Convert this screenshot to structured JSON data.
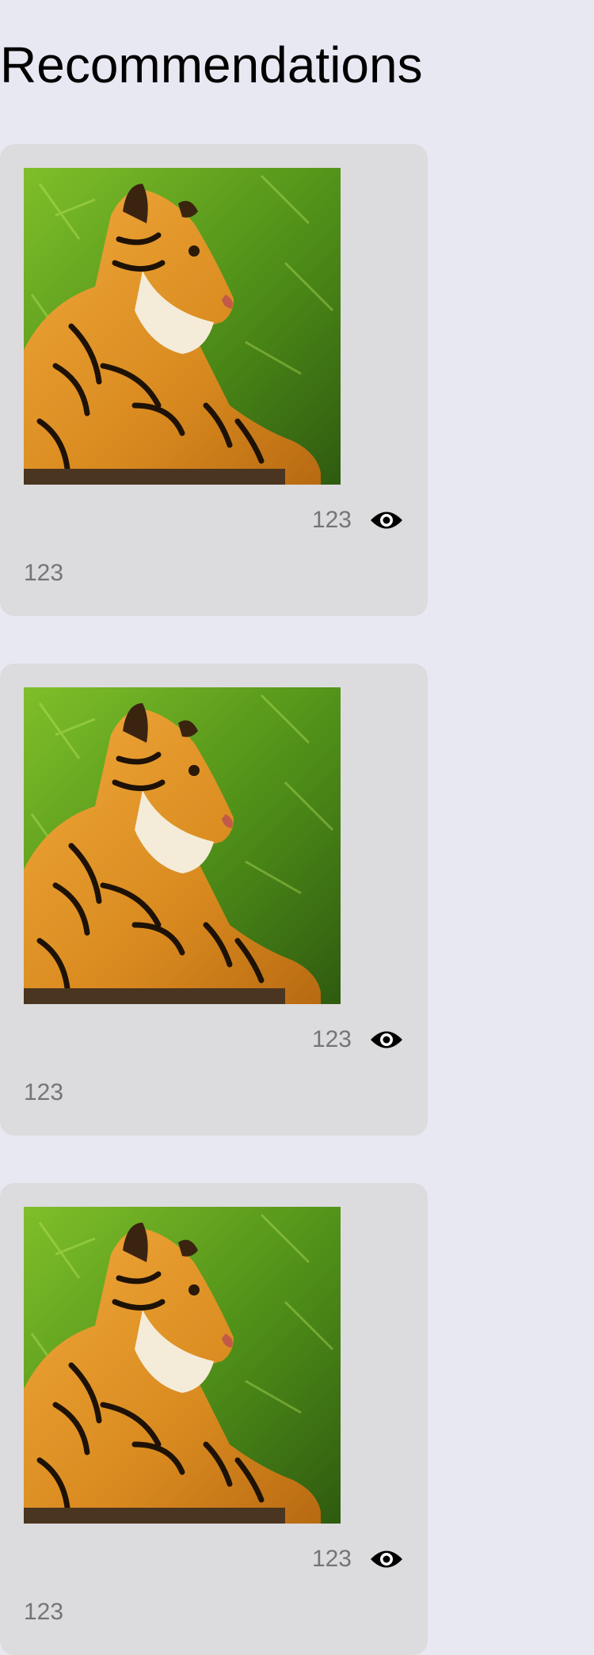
{
  "header": {
    "title": "Recommendations"
  },
  "recommendations": [
    {
      "views": "123",
      "caption": "123",
      "image": "tiger-photo"
    },
    {
      "views": "123",
      "caption": "123",
      "image": "tiger-photo"
    },
    {
      "views": "123",
      "caption": "123",
      "image": "tiger-photo"
    }
  ],
  "icons": {
    "views": "eye-icon"
  },
  "colors": {
    "page_background": "#e8e8f2",
    "card_background": "#dcdbdd",
    "secondary_text": "#757575",
    "title_text": "#000000"
  }
}
